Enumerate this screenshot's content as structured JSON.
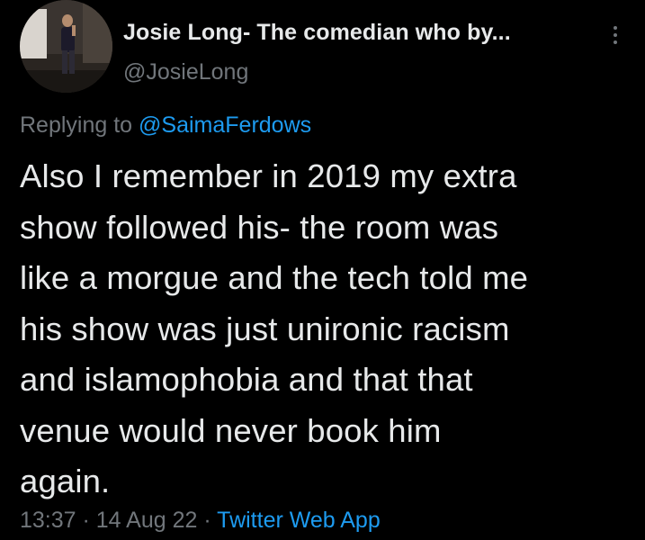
{
  "colors": {
    "background": "#000000",
    "primary_text": "#e7e9ea",
    "secondary_text": "#71767b",
    "link": "#1d9bf0"
  },
  "author": {
    "display_name": "Josie Long- The comedian who by...",
    "handle": "@JosieLong",
    "avatar_icon": "profile-photo"
  },
  "menu": {
    "icon": "more-vertical-icon"
  },
  "reply": {
    "prefix": "Replying to ",
    "mention": "@SaimaFerdows"
  },
  "tweet": {
    "text": "Also I remember in 2019 my extra\nshow followed his- the room was\nlike a morgue and the tech told me\nhis show was just unironic racism\nand islamophobia and that that\nvenue would never book him\nagain."
  },
  "meta": {
    "time": "13:37",
    "separator": " · ",
    "date": "14 Aug 22",
    "source": "Twitter Web App"
  }
}
